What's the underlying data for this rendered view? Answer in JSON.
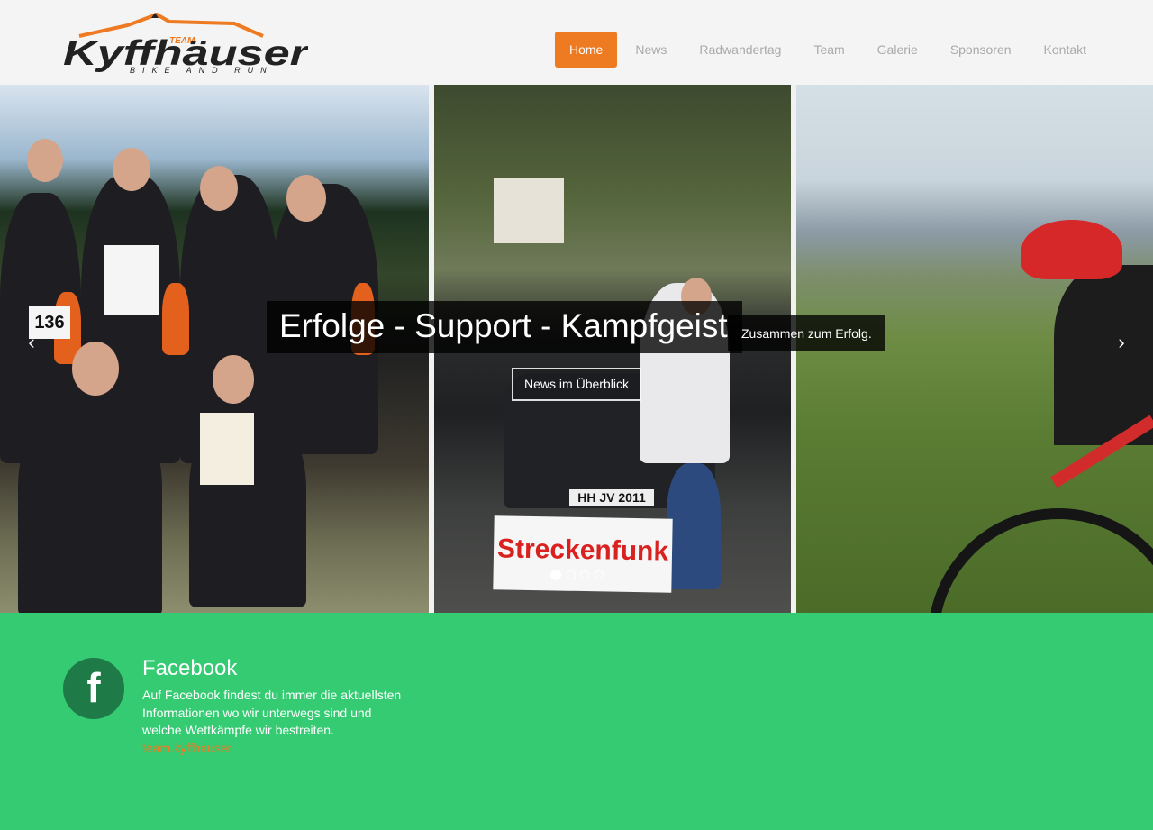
{
  "brand": {
    "logo_small": "TEAM",
    "logo_main": "Kyffhäuser",
    "logo_sub": "BIKE AND RUN",
    "accent_color": "#ee7a21",
    "footer_color": "#34cb72"
  },
  "nav": {
    "items": [
      {
        "label": "Home",
        "active": true
      },
      {
        "label": "News",
        "active": false
      },
      {
        "label": "Radwandertag",
        "active": false
      },
      {
        "label": "Team",
        "active": false
      },
      {
        "label": "Galerie",
        "active": false
      },
      {
        "label": "Sponsoren",
        "active": false
      },
      {
        "label": "Kontakt",
        "active": false
      }
    ]
  },
  "slider": {
    "title": "Erfolge - Support - Kampfgeist",
    "subtitle": "Zusammen zum Erfolg.",
    "button_label": "News im Überblick",
    "prev_icon": "‹",
    "next_icon": "›",
    "photo_texts": {
      "bib_number": "136",
      "sign": "Streckenfunk",
      "plate": "HH JV 2011"
    },
    "slides_total": 4,
    "active_slide": 1
  },
  "social": {
    "icon": "facebook-icon",
    "icon_glyph": "f",
    "title": "Facebook",
    "text": "Auf Facebook findest du immer die aktuellsten Informationen wo wir unterwegs sind und welche Wettkämpfe wir bestreiten.",
    "link_label": "team.kyffhauser"
  }
}
